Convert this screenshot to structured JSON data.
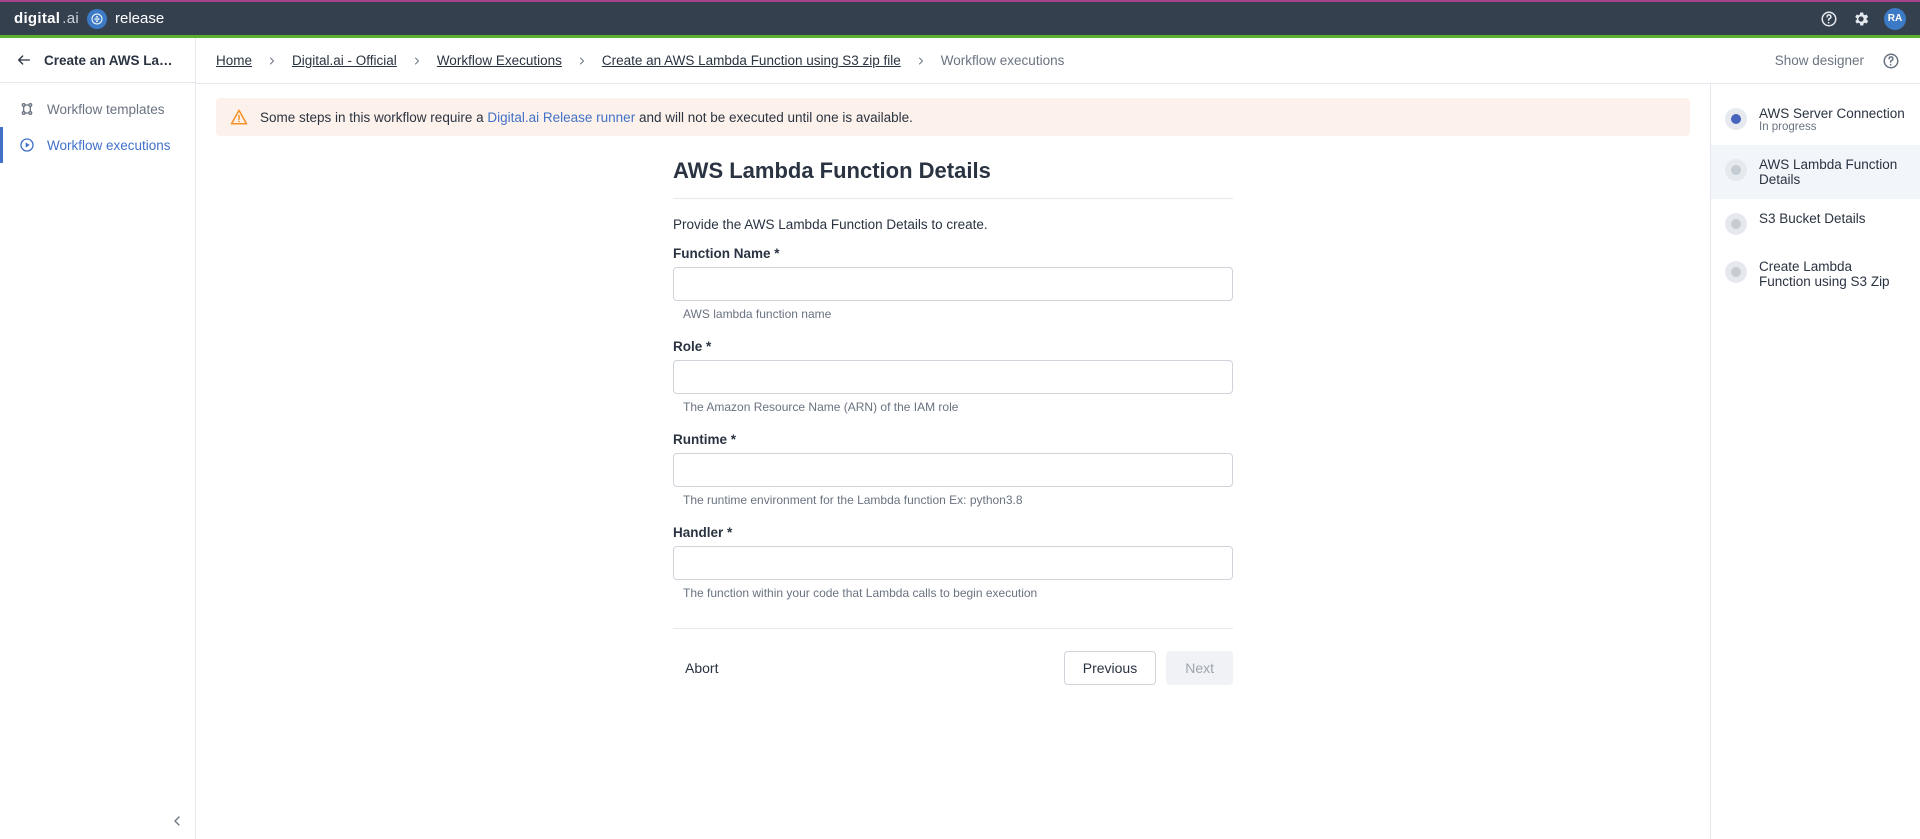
{
  "topbar": {
    "brand_primary": "digital",
    "brand_suffix": ".ai",
    "product_name": "release",
    "avatar_initials": "RA"
  },
  "sidebar": {
    "back_title": "Create an AWS Lambd...",
    "items": [
      {
        "label": "Workflow templates",
        "active": false
      },
      {
        "label": "Workflow executions",
        "active": true
      }
    ],
    "collapse_tooltip": "Collapse"
  },
  "breadcrumb": {
    "items": [
      "Home",
      "Digital.ai - Official",
      "Workflow Executions",
      "Create an AWS Lambda Function using S3 zip file"
    ],
    "current": "Workflow executions"
  },
  "header_right": {
    "show_designer": "Show designer"
  },
  "banner": {
    "prefix": "Some steps in this workflow require a ",
    "link_text": "Digital.ai Release runner",
    "suffix": " and will not be executed until one is available."
  },
  "form": {
    "title": "AWS Lambda Function Details",
    "description": "Provide the AWS Lambda Function Details to create.",
    "fields": {
      "function_name": {
        "label": "Function Name *",
        "value": "",
        "help": "AWS lambda function name"
      },
      "role": {
        "label": "Role *",
        "value": "",
        "help": "The Amazon Resource Name (ARN) of the IAM role"
      },
      "runtime": {
        "label": "Runtime *",
        "value": "",
        "help": "The runtime environment for the Lambda function Ex: python3.8"
      },
      "handler": {
        "label": "Handler *",
        "value": "",
        "help": "The function within your code that Lambda calls to begin execution"
      }
    },
    "actions": {
      "abort": "Abort",
      "previous": "Previous",
      "next": "Next"
    }
  },
  "steps": [
    {
      "title": "AWS Server Connection",
      "subtitle": "In progress",
      "state": "in-progress"
    },
    {
      "title": "AWS Lambda Function Details",
      "subtitle": "",
      "state": "active"
    },
    {
      "title": "S3 Bucket Details",
      "subtitle": "",
      "state": "pending"
    },
    {
      "title": "Create Lambda Function using S3 Zip",
      "subtitle": "",
      "state": "pending"
    }
  ]
}
